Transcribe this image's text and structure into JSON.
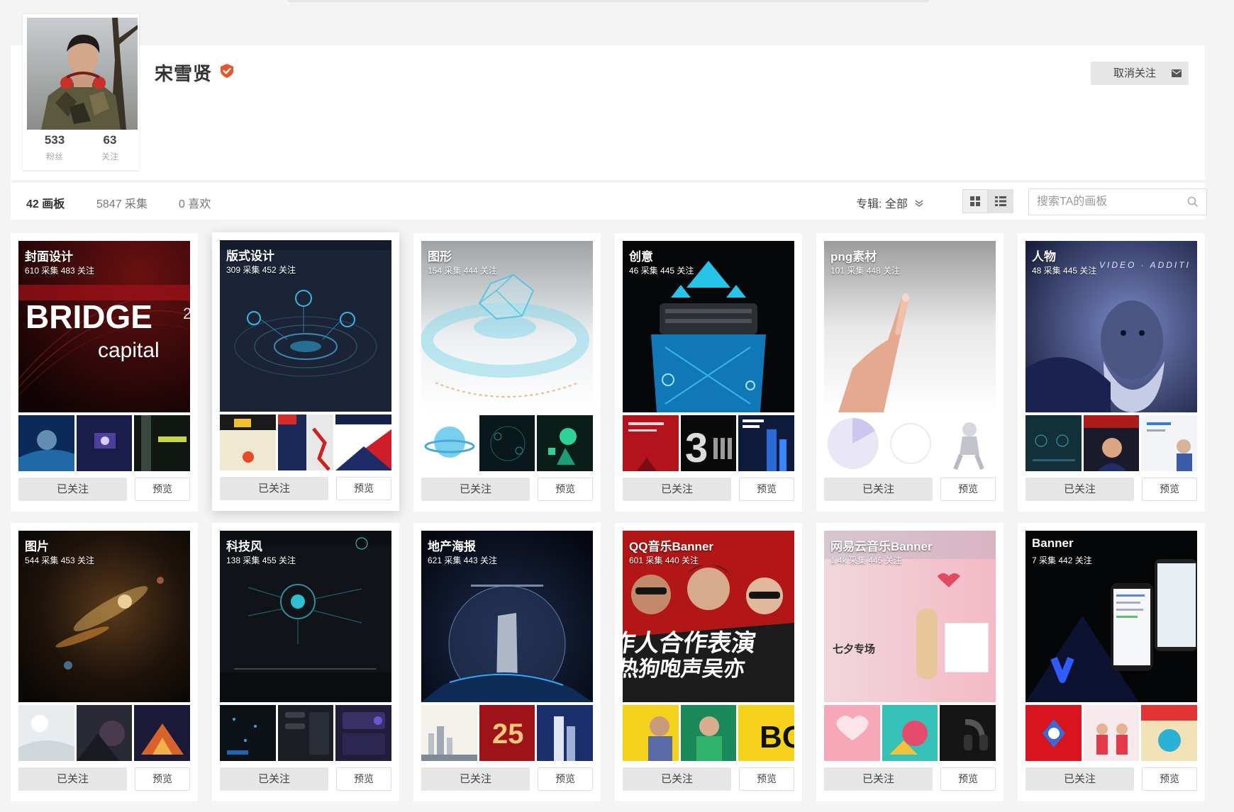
{
  "profile": {
    "name": "宋雪贤",
    "followers_count": "533",
    "followers_label": "粉丝",
    "following_count": "63",
    "following_label": "关注",
    "unfollow_label": "取消关注"
  },
  "tabs": [
    {
      "label": "42 画板"
    },
    {
      "label": "5847 采集"
    },
    {
      "label": "0 喜欢"
    }
  ],
  "album_filter": {
    "label": "专辑: 全部"
  },
  "search": {
    "placeholder": "搜索TA的画板"
  },
  "board_follow_label": "已关注",
  "board_preview_label": "预览",
  "boards": [
    {
      "title": "封面设计",
      "meta": "610 采集  483 关注"
    },
    {
      "title": "版式设计",
      "meta": "309 采集  452 关注"
    },
    {
      "title": "图形",
      "meta": "154 采集  444 关注"
    },
    {
      "title": "创意",
      "meta": "46 采集  445 关注"
    },
    {
      "title": "png素材",
      "meta": "101 采集  448 关注"
    },
    {
      "title": "人物",
      "meta": "48 采集  445 关注"
    },
    {
      "title": "图片",
      "meta": "544 采集  453 关注"
    },
    {
      "title": "科技风",
      "meta": "138 采集  455 关注"
    },
    {
      "title": "地产海报",
      "meta": "621 采集  443 关注"
    },
    {
      "title": "QQ音乐Banner",
      "meta": "601 采集  440 关注"
    },
    {
      "title": "网易云音乐Banner",
      "meta": "1.4k 采集  445 关注"
    },
    {
      "title": "Banner",
      "meta": "7 采集  442 关注"
    }
  ],
  "cover_texts": {
    "bridge_word": "BRIDGE",
    "capital_word": "capital",
    "bridge_side": "2",
    "banner_text": "作人合作表演",
    "banner_text2": "热狗咆声吴亦",
    "qixi_text": "七夕专场",
    "video_text": "VIDEO · ADDITI",
    "number_3": "3"
  },
  "colors": {
    "verified": "#e8542c",
    "follow_bg": "#e6e6e6"
  },
  "icons": {
    "verified": "verified-badge-icon",
    "mail": "mail-icon",
    "grid_large": "grid-large-icon",
    "grid_small": "grid-small-icon",
    "search": "search-icon",
    "chevron": "chevron-down-icon"
  }
}
